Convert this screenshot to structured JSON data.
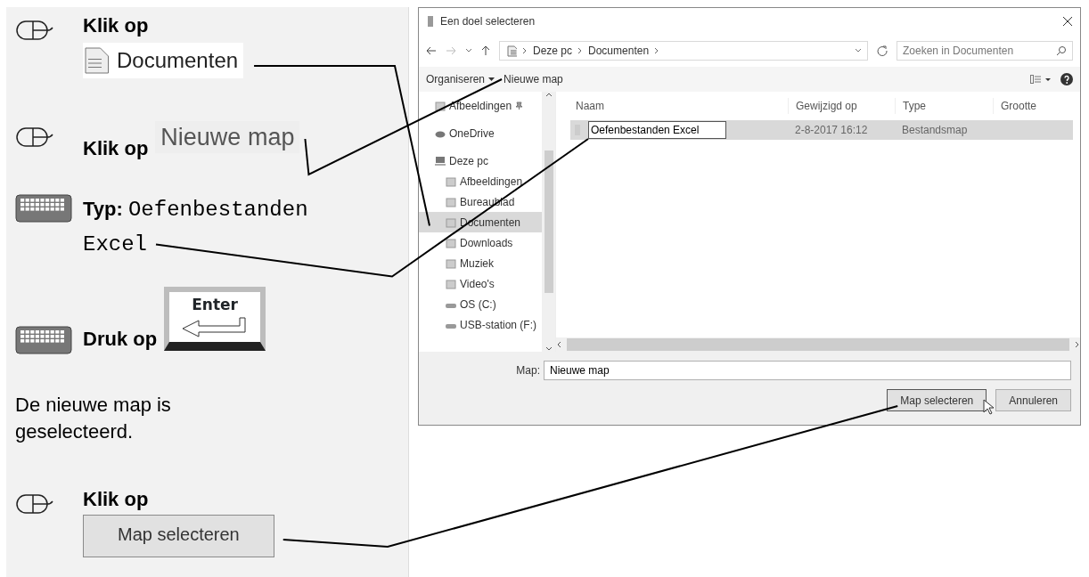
{
  "instructions": [
    {
      "kind": "click",
      "label": "Klik op",
      "target": {
        "kind": "nav",
        "text": "Documenten"
      }
    },
    {
      "kind": "click",
      "label": "Klik op",
      "target": {
        "kind": "toolbar",
        "text": "Nieuwe map"
      }
    },
    {
      "kind": "type",
      "label": "Typ:",
      "value": "Oefenbestanden Excel"
    },
    {
      "kind": "press",
      "label": "Druk op",
      "key": "Enter"
    },
    {
      "kind": "note",
      "text": "De nieuwe map is geselecteerd."
    },
    {
      "kind": "click",
      "label": "Klik op",
      "target": {
        "kind": "button",
        "text": "Map selecteren"
      }
    }
  ],
  "dialog": {
    "title": "Een doel selecteren",
    "breadcrumb": [
      "Deze pc",
      "Documenten"
    ],
    "search": {
      "placeholder": "Zoeken in Documenten"
    },
    "toolbar": [
      {
        "label": "Organiseren",
        "dropdown": true
      },
      {
        "label": "Nieuwe map",
        "dropdown": false
      }
    ],
    "nav": [
      {
        "label": "Afbeeldingen",
        "pinned": true,
        "selected": false
      },
      {
        "label": "OneDrive",
        "pinned": false,
        "selected": false
      },
      {
        "label": "Deze pc",
        "pinned": false,
        "selected": false,
        "children": [
          {
            "label": "Afbeeldingen",
            "selected": false
          },
          {
            "label": "Bureaublad",
            "selected": false
          },
          {
            "label": "Documenten",
            "selected": true
          },
          {
            "label": "Downloads",
            "selected": false
          },
          {
            "label": "Muziek",
            "selected": false
          },
          {
            "label": "Video's",
            "selected": false
          },
          {
            "label": "OS (C:)",
            "selected": false
          },
          {
            "label": "USB-station (F:)",
            "selected": false
          }
        ]
      }
    ],
    "columns": [
      "Naam",
      "Gewijzigd op",
      "Type",
      "Grootte"
    ],
    "rows": [
      {
        "name": "Oefenbestanden Excel",
        "editing": true,
        "modified": "2-8-2017 16:12",
        "type": "Bestandsmap",
        "selected": true
      }
    ],
    "folder": {
      "label": "Map:",
      "value": "Nieuwe map"
    },
    "buttons": [
      {
        "label": "Map selecteren",
        "focused": true
      },
      {
        "label": "Annuleren",
        "focused": false
      }
    ]
  }
}
